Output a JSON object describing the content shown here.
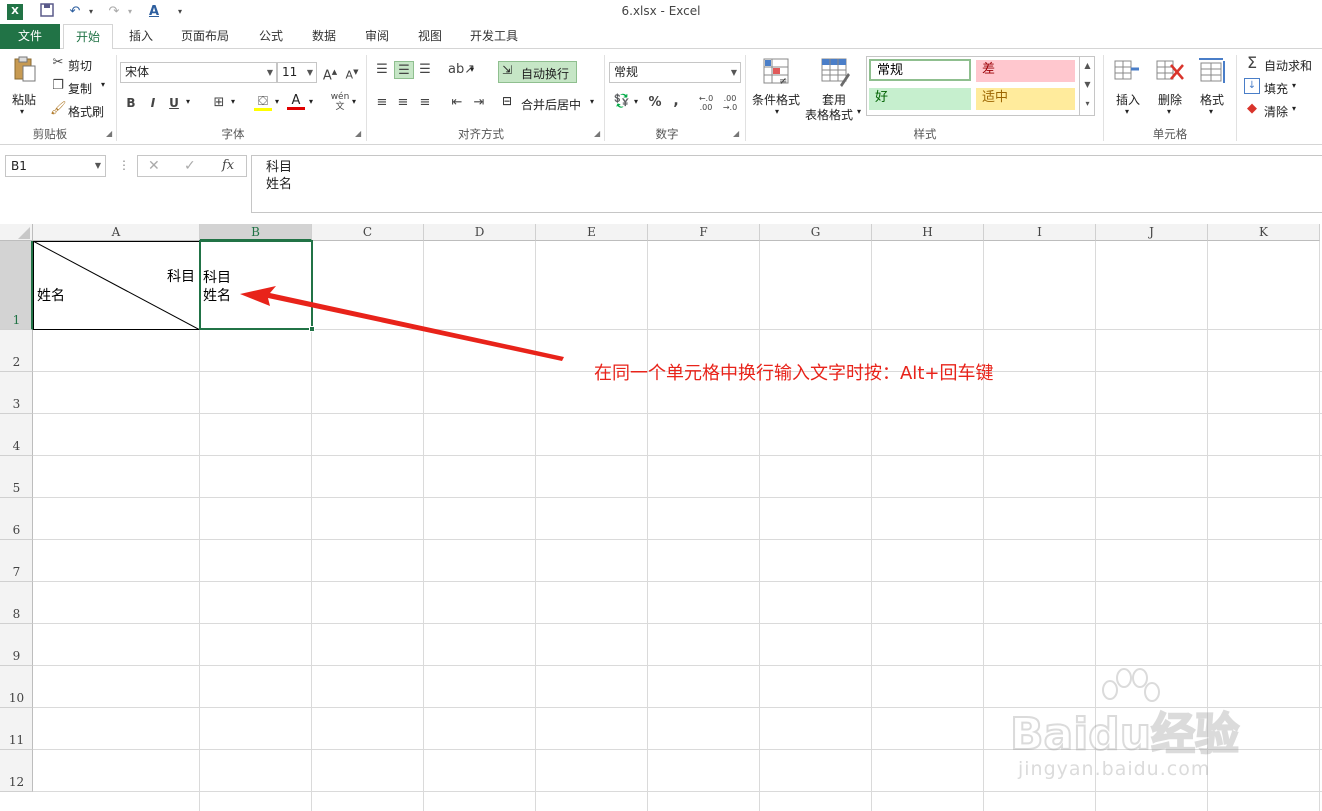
{
  "window": {
    "title": "6.xlsx - Excel"
  },
  "tabs": [
    "文件",
    "开始",
    "插入",
    "页面布局",
    "公式",
    "数据",
    "审阅",
    "视图",
    "开发工具"
  ],
  "ribbon": {
    "clipboard": {
      "paste": "粘贴",
      "cut": "剪切",
      "copy": "复制",
      "format_painter": "格式刷",
      "label": "剪贴板"
    },
    "font": {
      "name": "宋体",
      "size": "11",
      "bold": "B",
      "italic": "I",
      "underline": "U",
      "label": "字体"
    },
    "alignment": {
      "wrap_text": "自动换行",
      "merge_center": "合并后居中",
      "label": "对齐方式"
    },
    "number": {
      "format": "常规",
      "percent": "%",
      "comma": ",",
      "label": "数字"
    },
    "styles": {
      "conditional": "条件格式",
      "table_line1": "套用",
      "table_line2": "表格格式",
      "cells": [
        "常规",
        "差",
        "好",
        "适中"
      ],
      "label": "样式"
    },
    "cells": {
      "insert": "插入",
      "delete": "删除",
      "format": "格式",
      "label": "单元格"
    },
    "editing": {
      "autosum": "自动求和",
      "fill": "填充",
      "clear": "清除"
    }
  },
  "formula_bar": {
    "name_box": "B1",
    "fx": "fx",
    "content_line1": "科目",
    "content_line2": "姓名"
  },
  "sheet": {
    "columns": [
      "A",
      "B",
      "C",
      "D",
      "E",
      "F",
      "G",
      "H",
      "I",
      "J",
      "K"
    ],
    "rows": [
      "1",
      "2",
      "3",
      "4",
      "5",
      "6",
      "7",
      "8",
      "9",
      "10",
      "11",
      "12"
    ],
    "a1_top_right": "科目",
    "a1_bottom_left": "姓名",
    "b1_line1": "科目",
    "b1_line2": "姓名"
  },
  "annotation": "在同一个单元格中换行输入文字时按：Alt+回车键",
  "watermark": {
    "brand": "Baidu经验",
    "url": "jingyan.baidu.com"
  },
  "colors": {
    "accent": "#217346",
    "annotation": "#e8231a",
    "bad_fill": "#ffc7ce",
    "good_fill": "#c6efce",
    "neutral_fill": "#ffeb9c"
  }
}
